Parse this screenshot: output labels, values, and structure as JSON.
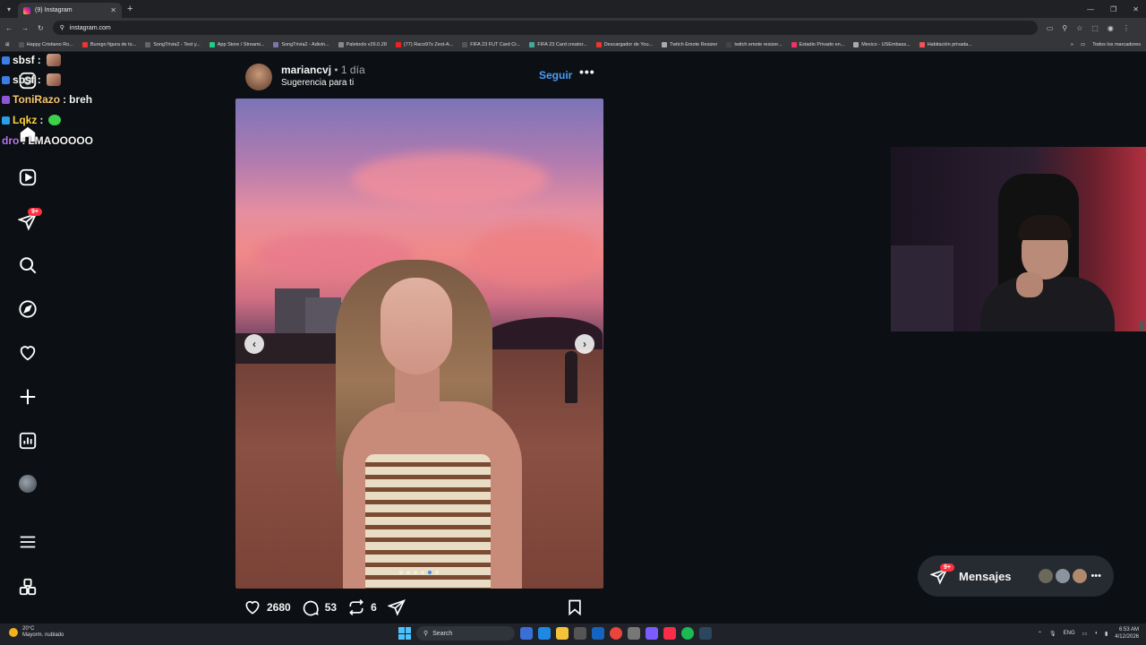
{
  "browser": {
    "tab_title": "(9) Instagram",
    "url": "instagram.com",
    "bookmarks": [
      {
        "label": "Happy Cristiano Ro...",
        "color": "#555"
      },
      {
        "label": "Burego figura de to...",
        "color": "#e33"
      },
      {
        "label": "SongTrivia2 - Test y...",
        "color": "#666"
      },
      {
        "label": "App Store / Streami...",
        "color": "#2c8"
      },
      {
        "label": "SongTrivia2 - Adivin...",
        "color": "#77a"
      },
      {
        "label": "Paletools v26.0.28",
        "color": "#888"
      },
      {
        "label": "(77) Raco97s Zest-A...",
        "color": "#e22"
      },
      {
        "label": "FIFA 23 FUT Card Cr...",
        "color": "#555"
      },
      {
        "label": "FIFA 23 Card creator...",
        "color": "#4a9"
      },
      {
        "label": "Descargador de You...",
        "color": "#e33"
      },
      {
        "label": "Twitch Emote Resizer",
        "color": "#aaa"
      },
      {
        "label": "twitch emote resizer...",
        "color": "#444"
      },
      {
        "label": "Estadio Privado en...",
        "color": "#e36"
      },
      {
        "label": "Mexico - USEmbass...",
        "color": "#aaa"
      },
      {
        "label": "Habitación privada...",
        "color": "#e55"
      }
    ],
    "all_bookmarks": "Todos los marcadores"
  },
  "chat": [
    {
      "user": "sbsf",
      "sep": ":",
      "msg": "",
      "color": "#ffffff",
      "emote": "face"
    },
    {
      "user": "sbsf",
      "sep": ":",
      "msg": "",
      "color": "#ffffff",
      "emote": "face"
    },
    {
      "user": "ToniRazo",
      "sep": ":",
      "msg": "breh",
      "color": "#f7c873",
      "emote": ""
    },
    {
      "user": "Lqkz",
      "sep": ":",
      "msg": "",
      "color": "#ffd43b",
      "emote": "green"
    },
    {
      "user": "dro",
      "sep": ":",
      "msg": "LMAOOOOO",
      "color": "#b878f0",
      "emote": ""
    }
  ],
  "sidebar": {
    "notifications_badge": "9+"
  },
  "post": {
    "username": "mariancvj",
    "time": "• 1 día",
    "subtitle": "Sugerencia para ti",
    "follow": "Seguir",
    "more": "•••",
    "likes": "2680",
    "comments": "53",
    "reposts": "6",
    "carousel_total": 6,
    "carousel_active": 5
  },
  "messages": {
    "label": "Mensajes",
    "badge": "9+",
    "more": "•••"
  },
  "taskbar": {
    "temperature": "20°C",
    "weather": "Mayorm. nublado",
    "search": "Search",
    "lang": "ENG",
    "time": "6:53 AM",
    "date": "4/12/2026"
  }
}
